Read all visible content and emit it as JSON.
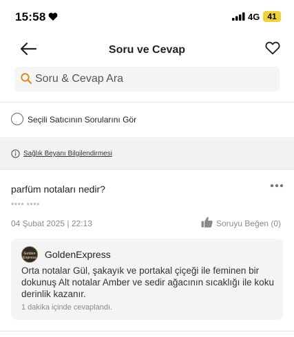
{
  "status_bar": {
    "time": "15:58",
    "network": "4G",
    "battery": "41"
  },
  "nav": {
    "title": "Soru ve Cevap"
  },
  "search": {
    "placeholder": "Soru & Cevap Ara"
  },
  "filter": {
    "seller_questions_label": "Seçili Satıcının Sorularını Gör"
  },
  "health": {
    "link_label": "Sağlık Beyanı Bilgilendirmesi"
  },
  "question": {
    "text": "parfüm notaları nedir?",
    "asker": "**** ****",
    "date": "04 Şubat 2025 | 22:13",
    "like_label": "Soruyu Beğen (0)"
  },
  "answer": {
    "seller_name": "GoldenExpress",
    "avatar_text": "Golden Express",
    "text": "Orta notalar Gül, şakayık ve portakal çiçeği ile feminen bir dokunuş Alt notalar Amber ve sedir ağacının sıcaklığı ile koku derinlik kazanır.",
    "time": "1 dakika içinde cevaplandı."
  },
  "colors": {
    "search_icon": "#e08a1e",
    "battery": "#f2d23a",
    "band": "#f2f2f2"
  }
}
